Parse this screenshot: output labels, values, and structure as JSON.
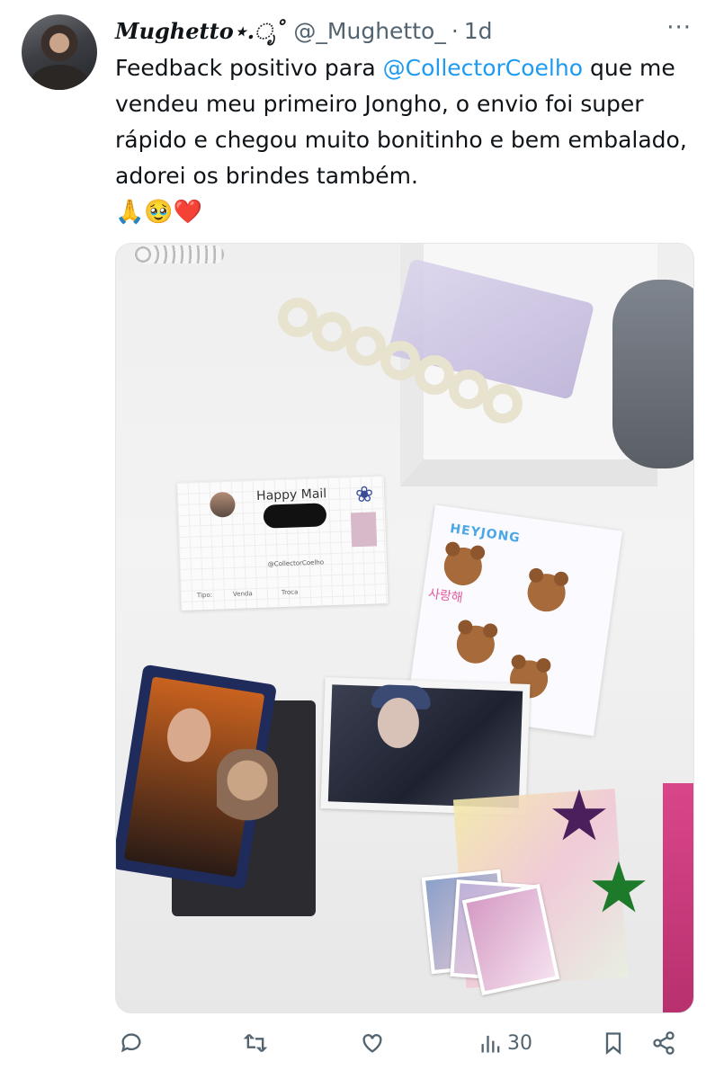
{
  "tweet": {
    "display_name": "Mughetto⋆.ೃ˚",
    "handle": "@_Mughetto_",
    "separator": "·",
    "time": "1d",
    "more": "···",
    "text_before": "Feedback positivo para ",
    "mention": "@CollectorCoelho",
    "text_after": " que me vendeu meu primeiro Jongho, o envio foi super rápido e chegou muito bonitinho e bem embalado, adorei os brindes também.",
    "emojis": "🙏🥹❤️"
  },
  "media": {
    "card": {
      "title": "Happy Mail",
      "handle": "@CollectorCoelho",
      "tipo": "Tipo:",
      "venda": "Venda",
      "troca": "Troca"
    },
    "sticker_sheet": {
      "title": "HEYJONG",
      "korean": "사랑해"
    }
  },
  "actions": {
    "reply_icon": "reply-icon",
    "retweet_icon": "retweet-icon",
    "like_icon": "heart-icon",
    "views_icon": "views-icon",
    "views_count": "30",
    "bookmark_icon": "bookmark-icon",
    "share_icon": "share-icon"
  },
  "colors": {
    "text": "#0f1419",
    "secondary": "#536471",
    "link": "#1d9bf0"
  }
}
